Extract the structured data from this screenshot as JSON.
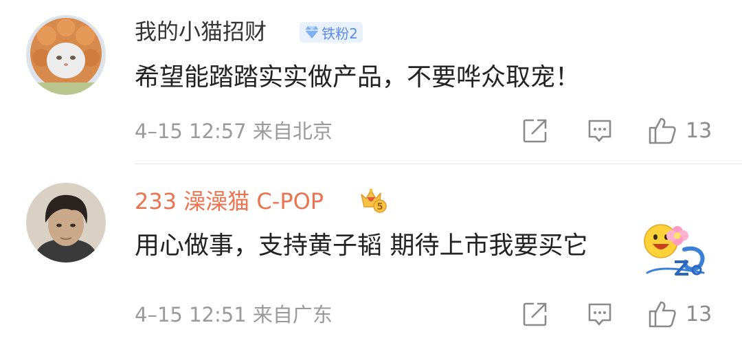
{
  "comments": [
    {
      "user": "我的小猫招财",
      "badge": "铁粉2",
      "text": "希望能踏踏实实做产品，不要哗众取宠！",
      "time": "4–15 12:57",
      "location": "来自北京",
      "likes": "13",
      "avatar": "cat-avatar"
    },
    {
      "user": "233 澡澡猫 C-POP",
      "badge_icon": "crown-level-5-icon",
      "text": "用心做事，支持黄子韬 期待上市我要买它",
      "sticker": "happy-face-z-tao-sticker",
      "time": "4–15 12:51",
      "location": "来自广东",
      "likes": "13",
      "avatar": "person-avatar"
    }
  ],
  "colors": {
    "username_default": "#333333",
    "username_vip": "#eb7350",
    "meta": "#9a9a9a",
    "badge_bg": "#e9f1fd",
    "badge_text": "#5b8be8",
    "icon": "#8a8a8a"
  },
  "icons": [
    "share-icon",
    "comment-icon",
    "like-icon"
  ]
}
